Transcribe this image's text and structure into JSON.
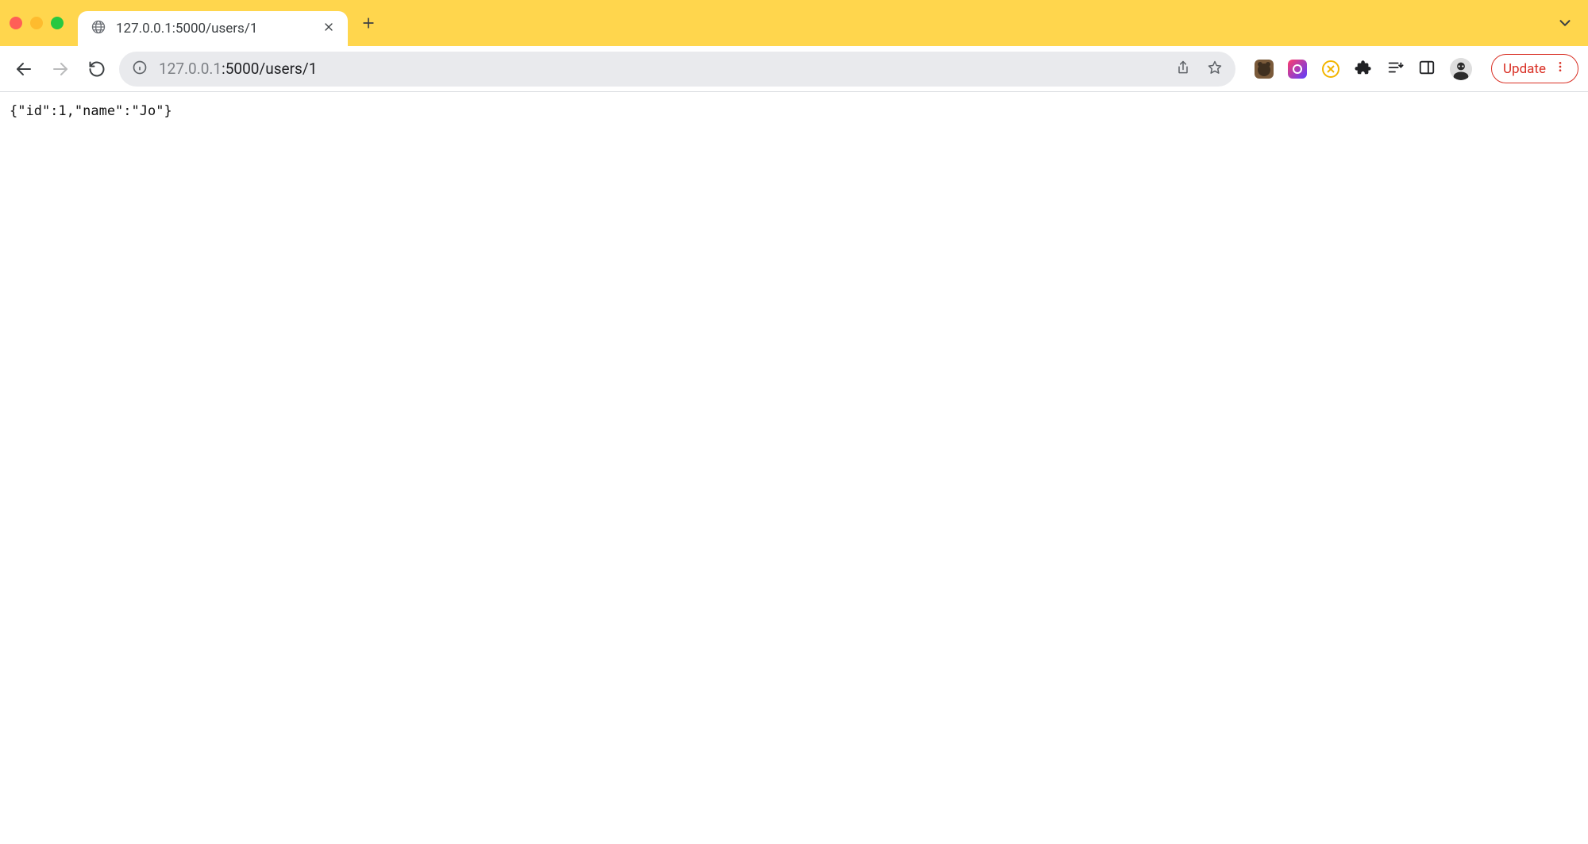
{
  "tab": {
    "title": "127.0.0.1:5000/users/1"
  },
  "url": {
    "host": "127.0.0.1",
    "path": ":5000/users/1"
  },
  "update_label": "Update",
  "page_body": "{\"id\":1,\"name\":\"Jo\"}"
}
